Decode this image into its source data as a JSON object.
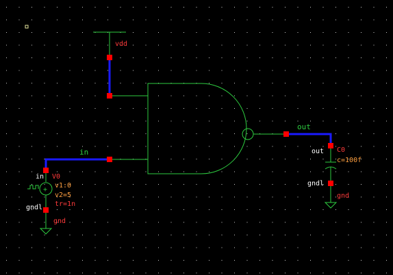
{
  "schematic": {
    "colors": {
      "background": "#000000",
      "grid_dot": "#cfcfcf",
      "device": "#2ecc40",
      "wire": "#1a1aff",
      "pin": "#ff0000",
      "net_label": "#ffa040",
      "pin_label": "#ffffff",
      "device_label": "#ff3b3b"
    },
    "net_labels": {
      "in": "in",
      "out": "out"
    },
    "supply": {
      "vdd_label": "vdd"
    },
    "source_v0": {
      "pin_top_label": "in",
      "pin_bottom_label": "gndl",
      "instance": "V0",
      "param_v1": "v1:0",
      "param_v2": "v2=5",
      "param_tr": "tr=1n",
      "ground_label": "gnd"
    },
    "cap_c0": {
      "pin_top_label": "out",
      "pin_bottom_label": "gndl",
      "instance": "C0",
      "param_c": "c=100f",
      "ground_label": "gnd"
    }
  }
}
